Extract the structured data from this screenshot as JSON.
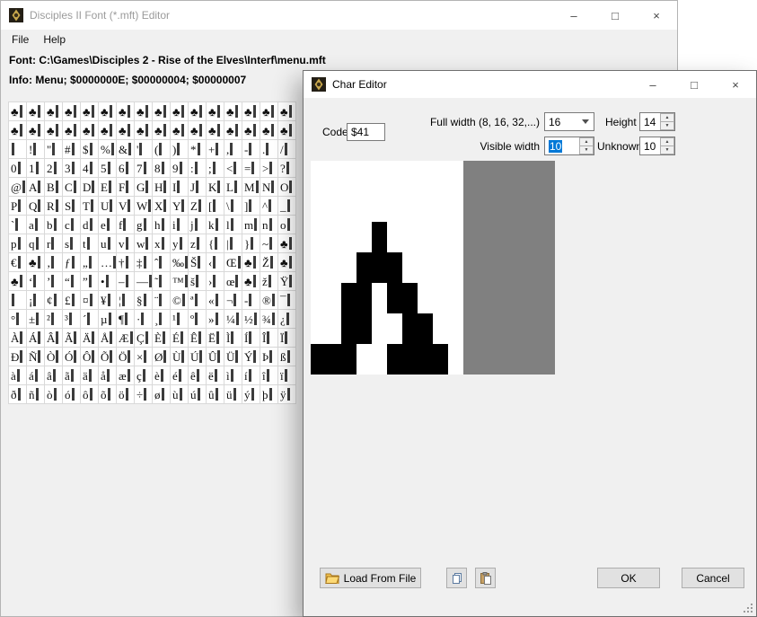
{
  "main_window": {
    "title": "Disciples II Font (*.mft) Editor",
    "window_buttons": {
      "minimize": "–",
      "maximize": "□",
      "close": "×"
    },
    "menu": {
      "file": "File",
      "help": "Help"
    },
    "font_line": "Font: C:\\Games\\Disciples 2 - Rise of the Elves\\Interf\\menu.mft",
    "info_line": "Info: Menu; $0000000E; $00000004; $00000007",
    "char_grid_rows": [
      "♣♣♣♣♣♣♣♣♣♣♣♣♣♣♣♣",
      "♣♣♣♣♣♣♣♣♣♣♣♣♣♣♣♣",
      " !\"#$%&'()*+,-./",
      "0123456789:;<=>?",
      "@ABCDEFGHIJKLMNO",
      "PQRSTUVWXYZ[\\]^_",
      "`abcdefghijklmno",
      "pqrstuvwxyz{|}~♣",
      "€♣‚ƒ„…†‡ˆ‰Š‹Œ♣Ž♣",
      "♣‘’“”•–—˜™š›œ♣žŸ",
      " ¡¢£¤¥¦§¨©ª«¬-®¯",
      "°±²³´µ¶·¸¹º»¼½¾¿",
      "ÀÁÂÃÄÅÆÇÈÉÊËÌÍÎÏ",
      "ÐÑÒÓÔÕÖ×ØÙÚÛÜÝÞß",
      "àáâãäåæçèéêëìíîï",
      "ðñòóôõö÷øùúûüýþÿ"
    ]
  },
  "char_editor": {
    "title": "Char Editor",
    "window_buttons": {
      "minimize": "–",
      "maximize": "□",
      "close": "×"
    },
    "fields": {
      "code_label": "Code",
      "code_value": "$41",
      "full_width_label": "Full width (8, 16, 32,...)",
      "full_width_value": "16",
      "height_label": "Height",
      "height_value": "14",
      "visible_width_label": "Visible width",
      "visible_width_value": "10",
      "unknown_label": "Unknown",
      "unknown_value": "10"
    },
    "preview": {
      "full_width": 16,
      "visible_width": 10,
      "height": 14,
      "ink_color": "#000000",
      "visible_bg": "#ffffff",
      "padding_bg": "#808080",
      "bitmap": [
        "..........",
        "..........",
        "..........",
        "..........",
        "....#.....",
        "....#.....",
        "...###....",
        "...###....",
        "..##.##...",
        "..##.##...",
        "..##..##..",
        "..##..##..",
        "###..####.",
        "###..####."
      ]
    },
    "buttons": {
      "load_from_file": "Load From File",
      "ok": "OK",
      "cancel": "Cancel"
    }
  },
  "colors": {
    "selection_blue": "#0078d7",
    "padding_gray": "#808080",
    "window_bg": "#f0f0f0"
  }
}
